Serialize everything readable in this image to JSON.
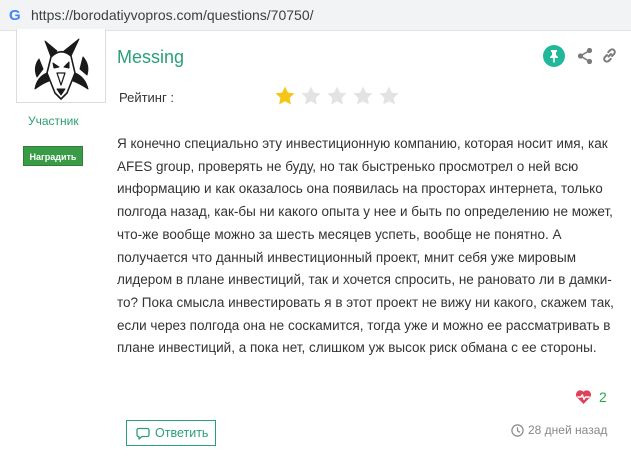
{
  "browser": {
    "logo_letter": "G",
    "url": "https://borodatiyvopros.com/questions/70750/"
  },
  "author": {
    "name": "Messing",
    "role": "Участник",
    "award_button": "Наградить"
  },
  "rating": {
    "label": "Рейтинг :",
    "value": 1,
    "max": 5,
    "filled_color": "#f5c518",
    "empty_color": "#e3e3e3"
  },
  "post": {
    "text": "Я конечно специально эту инвестиционную компанию, которая носит имя, как AFES group, проверять не буду, но так быстренько просмотрел о ней всю информацию и как оказалось она появилась на просторах интернета, только полгода назад, как-бы ни какого опыта у нее и быть по определению не может, что-же вообще можно за шесть месяцев успеть, вообще не понятно. А получается что данный инвестиционный проект, мнит себя уже мировым лидером в плане инвестиций, так и хочется спросить, не рановато ли в дамки-то? Пока смысла инвестировать я в этот проект не вижу ни какого, скажем так, если через полгода она не соскамится, тогда уже и можно ее рассматривать в плане инвестиций, а пока нет, слишком уж высок риск обмана с ее стороны."
  },
  "actions": {
    "likes": "2",
    "reply_label": "Ответить",
    "time_ago": "28 дней назад",
    "icons": [
      "pin-icon",
      "share-icon",
      "link-icon",
      "heart-pulse-icon",
      "comment-icon",
      "clock-icon"
    ]
  },
  "colors": {
    "accent": "#2aa077",
    "pin_bg": "#21b89a",
    "award_bg": "#3a9b46",
    "heart": "#e0415a",
    "likes": "#2aa84a"
  }
}
